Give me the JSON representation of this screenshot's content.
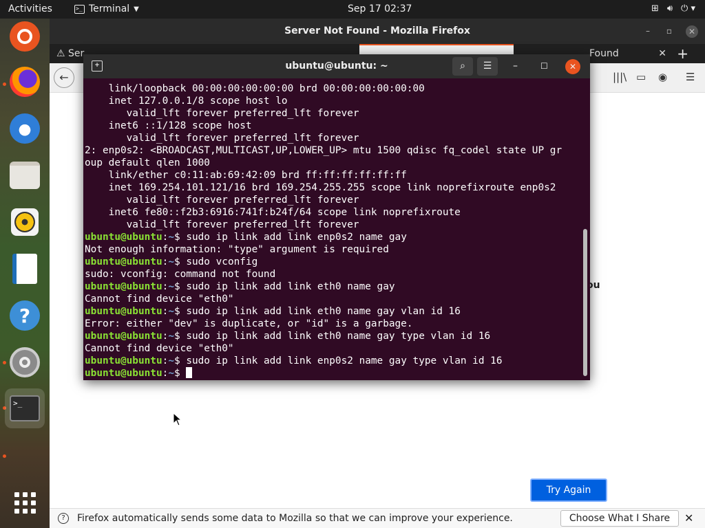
{
  "topbar": {
    "activities": "Activities",
    "app_name": "Terminal",
    "clock": "Sep 17  02:37"
  },
  "dock": {
    "items": [
      "ubuntu-software",
      "firefox",
      "thunderbird",
      "files",
      "rhythmbox",
      "libreoffice-writer",
      "help",
      "settings",
      "terminal",
      "show-applications"
    ]
  },
  "firefox": {
    "window_title": "Server Not Found - Mozilla Firefox",
    "tabs": [
      {
        "label": "Ser",
        "icon": "warning-icon"
      },
      {
        "label": "",
        "icon": ""
      },
      {
        "label": "",
        "icon": ""
      },
      {
        "label": "Found",
        "icon": ""
      }
    ],
    "partial_text": "ou",
    "try_again": "Try Again",
    "notice": {
      "text": "Firefox automatically sends some data to Mozilla so that we can improve your experience.",
      "button": "Choose What I Share"
    }
  },
  "terminal": {
    "title": "ubuntu@ubuntu: ~",
    "user": "ubuntu@ubuntu",
    "path": "~",
    "lines": [
      {
        "type": "out",
        "text": "    link/loopback 00:00:00:00:00:00 brd 00:00:00:00:00:00"
      },
      {
        "type": "out",
        "text": "    inet 127.0.0.1/8 scope host lo"
      },
      {
        "type": "out",
        "text": "       valid_lft forever preferred_lft forever"
      },
      {
        "type": "out",
        "text": "    inet6 ::1/128 scope host"
      },
      {
        "type": "out",
        "text": "       valid_lft forever preferred_lft forever"
      },
      {
        "type": "out",
        "text": "2: enp0s2: <BROADCAST,MULTICAST,UP,LOWER_UP> mtu 1500 qdisc fq_codel state UP gr"
      },
      {
        "type": "out",
        "text": "oup default qlen 1000"
      },
      {
        "type": "out",
        "text": "    link/ether c0:11:ab:69:42:09 brd ff:ff:ff:ff:ff:ff"
      },
      {
        "type": "out",
        "text": "    inet 169.254.101.121/16 brd 169.254.255.255 scope link noprefixroute enp0s2"
      },
      {
        "type": "out",
        "text": "       valid_lft forever preferred_lft forever"
      },
      {
        "type": "out",
        "text": "    inet6 fe80::f2b3:6916:741f:b24f/64 scope link noprefixroute"
      },
      {
        "type": "out",
        "text": "       valid_lft forever preferred_lft forever"
      },
      {
        "type": "cmd",
        "text": "sudo ip link add link enp0s2 name gay"
      },
      {
        "type": "out",
        "text": "Not enough information: \"type\" argument is required"
      },
      {
        "type": "cmd",
        "text": "sudo vconfig"
      },
      {
        "type": "out",
        "text": "sudo: vconfig: command not found"
      },
      {
        "type": "cmd",
        "text": "sudo ip link add link eth0 name gay"
      },
      {
        "type": "out",
        "text": "Cannot find device \"eth0\""
      },
      {
        "type": "cmd",
        "text": "sudo ip link add link eth0 name gay vlan id 16"
      },
      {
        "type": "out",
        "text": "Error: either \"dev\" is duplicate, or \"id\" is a garbage."
      },
      {
        "type": "cmd",
        "text": "sudo ip link add link eth0 name gay type vlan id 16"
      },
      {
        "type": "out",
        "text": "Cannot find device \"eth0\""
      },
      {
        "type": "cmd",
        "text": "sudo ip link add link enp0s2 name gay type vlan id 16"
      },
      {
        "type": "prompt",
        "text": ""
      }
    ]
  },
  "colors": {
    "terminal_bg": "#300a24",
    "prompt_user": "#8ae234",
    "prompt_path": "#729fcf",
    "accent": "#e95420",
    "button_blue": "#0060df"
  }
}
